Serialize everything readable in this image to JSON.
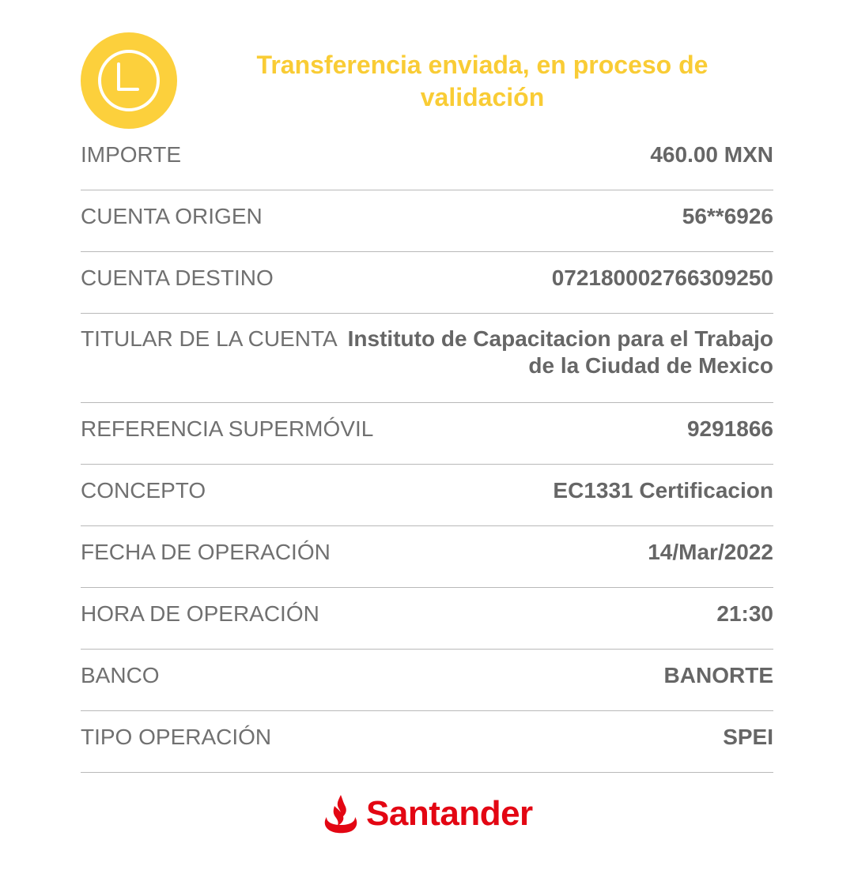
{
  "status": {
    "icon": "clock-icon",
    "title": "Transferencia enviada, en proceso de validación",
    "color": "#f9cc35"
  },
  "details": [
    {
      "label": "IMPORTE",
      "value": "460.00 MXN"
    },
    {
      "label": "CUENTA ORIGEN",
      "value": "56**6926"
    },
    {
      "label": "CUENTA DESTINO",
      "value": "072180002766309250"
    },
    {
      "label": "TITULAR DE LA CUENTA",
      "value": "Instituto de Capacitacion para el Trabajo de la Ciudad de Mexico"
    },
    {
      "label": "REFERENCIA SUPERMÓVIL",
      "value": "9291866"
    },
    {
      "label": "CONCEPTO",
      "value": "EC1331 Certificacion"
    },
    {
      "label": "FECHA DE OPERACIÓN",
      "value": "14/Mar/2022"
    },
    {
      "label": "HORA DE OPERACIÓN",
      "value": "21:30"
    },
    {
      "label": "BANCO",
      "value": "BANORTE"
    },
    {
      "label": "TIPO OPERACIÓN",
      "value": "SPEI"
    }
  ],
  "footer": {
    "logo_text": "Santander",
    "logo_icon": "santander-flame-icon",
    "brand_color": "#e30613"
  }
}
